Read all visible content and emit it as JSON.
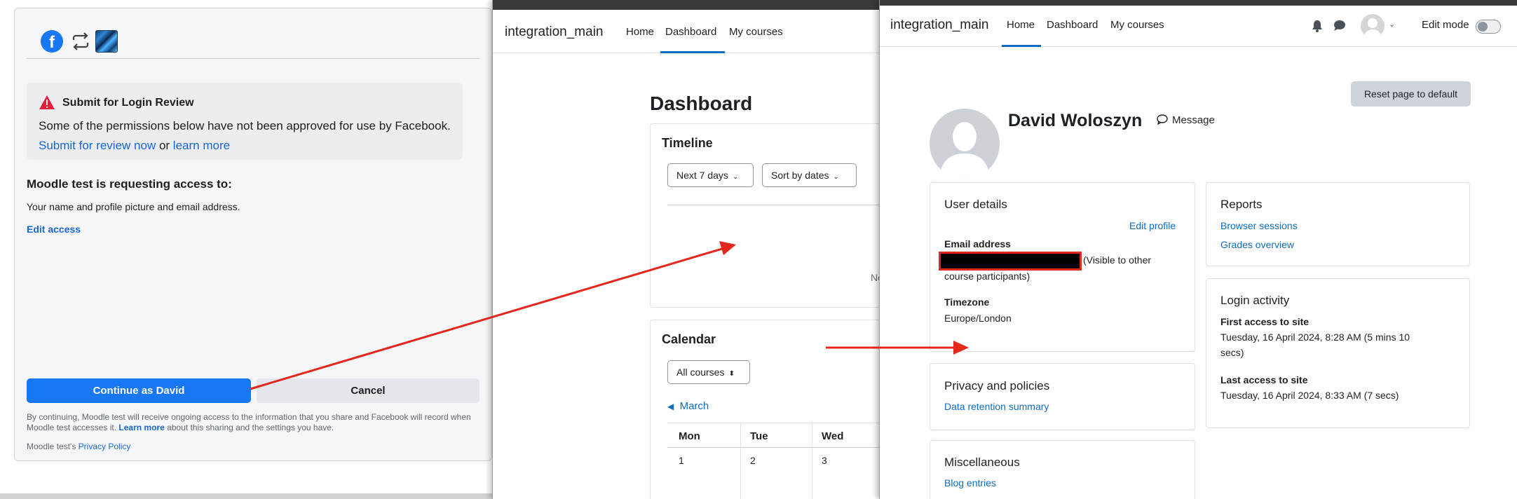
{
  "facebook_dialog": {
    "warning_title": "Submit for Login Review",
    "warning_body": "Some of the permissions below have not been approved for use by Facebook.",
    "submit_link": "Submit for review now",
    "or_text": " or ",
    "learn_more_link": "learn more",
    "request_title": "Moodle test is requesting access to:",
    "request_body": "Your name and profile picture and email address.",
    "edit_access": "Edit access",
    "continue_button": "Continue as David",
    "cancel_button": "Cancel",
    "disclaimer_a": "By continuing, Moodle test will receive ongoing access to the information that you share and Facebook will record when Moodle test accesses it. ",
    "disclaimer_link": "Learn more",
    "disclaimer_b": " about this sharing and the settings you have.",
    "policy_prefix": "Moodle test's ",
    "policy_link": "Privacy Policy",
    "brand_color": "#1877f2"
  },
  "dashboard_window": {
    "site_name": "integration_main",
    "nav": [
      "Home",
      "Dashboard",
      "My courses"
    ],
    "active_nav": "Dashboard",
    "page_title": "Dashboard",
    "timeline": {
      "title": "Timeline",
      "filter": "Next 7 days",
      "sort": "Sort by dates",
      "empty_text": "No"
    },
    "calendar": {
      "title": "Calendar",
      "course_filter": "All courses",
      "prev_month": "March",
      "weekdays": [
        "Mon",
        "Tue",
        "Wed"
      ],
      "days": [
        "1",
        "2",
        "3"
      ]
    }
  },
  "profile_window": {
    "site_name": "integration_main",
    "nav": [
      "Home",
      "Dashboard",
      "My courses"
    ],
    "active_nav": "Home",
    "edit_mode": "Edit mode",
    "reset_button": "Reset page to default",
    "user_name": "David Woloszyn",
    "message_link": "Message",
    "user_details": {
      "title": "User details",
      "edit_profile": "Edit profile",
      "email_label": "Email address",
      "email_visibility_a": "(Visible to other",
      "email_visibility_b": "course participants)",
      "timezone_label": "Timezone",
      "timezone_value": "Europe/London"
    },
    "privacy": {
      "title": "Privacy and policies",
      "link": "Data retention summary"
    },
    "misc": {
      "title": "Miscellaneous",
      "link": "Blog entries"
    },
    "reports": {
      "title": "Reports",
      "links": [
        "Browser sessions",
        "Grades overview"
      ]
    },
    "login_activity": {
      "title": "Login activity",
      "first_label": "First access to site",
      "first_value_a": "Tuesday, 16 April 2024, 8:28 AM  (5 mins 10",
      "first_value_b": "secs)",
      "last_label": "Last access to site",
      "last_value": "Tuesday, 16 April 2024, 8:33 AM  (7 secs)"
    },
    "accent_color": "#0f6cbf"
  },
  "annotation_color": "#e3271d"
}
